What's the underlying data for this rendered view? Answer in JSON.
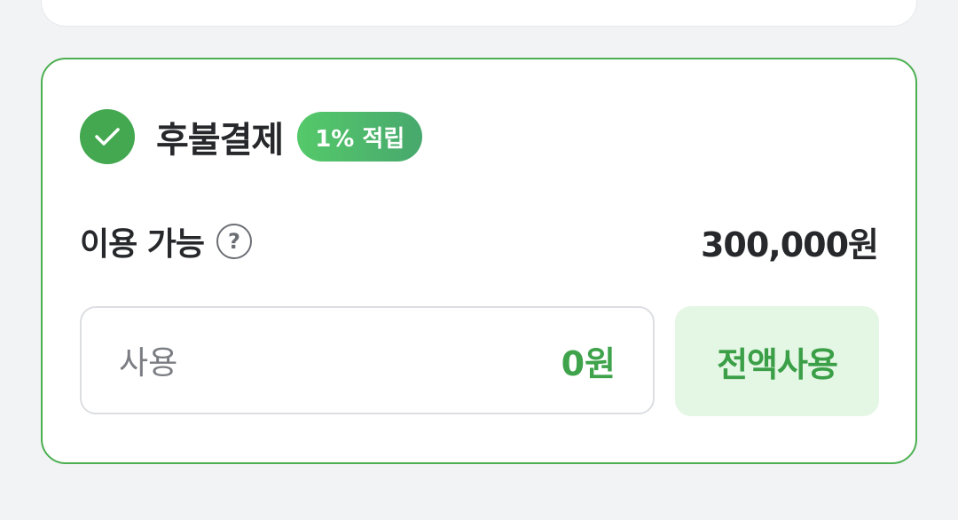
{
  "payment": {
    "title": "후불결제",
    "badge": "1% 적립",
    "selected": true,
    "available_label": "이용 가능",
    "help_icon": "?",
    "available_amount": "300,000원",
    "use_label": "사용",
    "use_value": "0원",
    "full_use_button": "전액사용"
  },
  "colors": {
    "accent": "#43a84f",
    "border": "#4caf50",
    "button_bg": "#e4f6e4",
    "text": "#26282b"
  }
}
